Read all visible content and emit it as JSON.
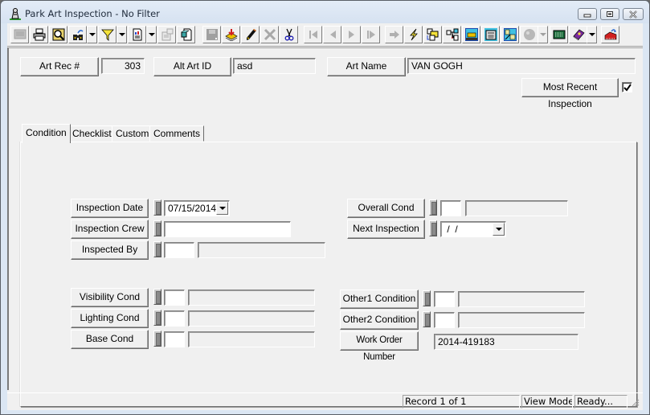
{
  "window": {
    "title": "Park Art Inspection - No Filter",
    "controls": [
      "minimize",
      "maximize",
      "close"
    ]
  },
  "toolbar": {
    "buttons": [
      {
        "name": "screen-icon",
        "enabled": false
      },
      {
        "name": "print-icon",
        "enabled": true
      },
      {
        "name": "print-preview-icon",
        "enabled": true
      },
      {
        "name": "find-icon",
        "enabled": true,
        "dropdown": true
      },
      {
        "name": "filter-icon",
        "enabled": true,
        "dropdown": true
      },
      {
        "name": "report-icon",
        "enabled": true,
        "dropdown": true
      },
      {
        "name": "properties-icon",
        "enabled": false
      },
      {
        "name": "copy-record-icon",
        "enabled": true
      },
      {
        "name": "save-icon",
        "enabled": false
      },
      {
        "name": "import-icon",
        "enabled": true
      },
      {
        "name": "edit-pencil-icon",
        "enabled": true
      },
      {
        "name": "delete-icon",
        "enabled": false
      },
      {
        "name": "cut-icon",
        "enabled": true
      },
      {
        "name": "first-record-icon",
        "enabled": false
      },
      {
        "name": "previous-record-icon",
        "enabled": false
      },
      {
        "name": "next-record-icon",
        "enabled": false
      },
      {
        "name": "last-record-icon",
        "enabled": false
      },
      {
        "name": "go-to-icon",
        "enabled": false
      },
      {
        "name": "lightning-icon",
        "enabled": true
      },
      {
        "name": "workflow-icon",
        "enabled": true
      },
      {
        "name": "hierarchy-icon",
        "enabled": true
      },
      {
        "name": "equipment-icon",
        "enabled": true
      },
      {
        "name": "calculator-icon",
        "enabled": true
      },
      {
        "name": "map-icon",
        "enabled": true
      },
      {
        "name": "gis-icon",
        "enabled": false,
        "dropdown": true
      },
      {
        "name": "keyboard-icon",
        "enabled": true
      },
      {
        "name": "help-book-icon",
        "enabled": true,
        "dropdown": true
      },
      {
        "name": "exit-icon",
        "enabled": true
      }
    ]
  },
  "header": {
    "art_rec_label": "Art Rec #",
    "art_rec_value": "303",
    "alt_art_id_label": "Alt Art ID",
    "alt_art_id_value": "asd",
    "art_name_label": "Art Name",
    "art_name_value": "VAN GOGH",
    "most_recent_label": "Most Recent Inspection",
    "most_recent_checked": true
  },
  "tabs": [
    {
      "label": "Condition",
      "active": true
    },
    {
      "label": "Checklist",
      "active": false
    },
    {
      "label": "Custom",
      "active": false
    },
    {
      "label": "Comments",
      "active": false
    }
  ],
  "condition": {
    "inspection_date_label": "Inspection Date",
    "inspection_date_value": "07/15/2014",
    "inspection_crew_label": "Inspection Crew",
    "inspection_crew_value": "",
    "inspected_by_label": "Inspected By",
    "inspected_by_code": "",
    "inspected_by_desc": "",
    "overall_cond_label": "Overall Cond",
    "overall_cond_code": "",
    "overall_cond_desc": "",
    "next_inspection_label": "Next Inspection",
    "next_inspection_value": " /  /",
    "visibility_cond_label": "Visibility Cond",
    "lighting_cond_label": "Lighting Cond",
    "base_cond_label": "Base Cond",
    "other1_label": "Other1 Condition",
    "other2_label": "Other2 Condition",
    "work_order_label": "Work Order Number",
    "work_order_value": "2014-419183"
  },
  "status": {
    "record": "Record 1 of 1",
    "mode": "View Mode",
    "state": "Ready..."
  }
}
